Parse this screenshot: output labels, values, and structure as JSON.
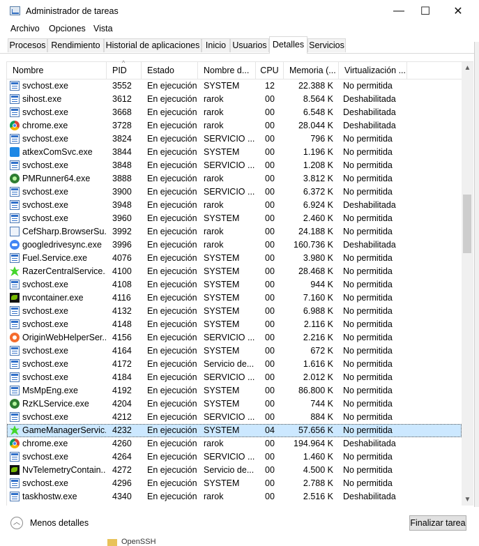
{
  "window": {
    "title": "Administrador de tareas",
    "minimize": "—",
    "maximize": "☐",
    "close": "✕"
  },
  "menu": [
    "Archivo",
    "Opciones",
    "Vista"
  ],
  "tabs": [
    {
      "label": "Procesos",
      "active": false
    },
    {
      "label": "Rendimiento",
      "active": false
    },
    {
      "label": "Historial de aplicaciones",
      "active": false
    },
    {
      "label": "Inicio",
      "active": false
    },
    {
      "label": "Usuarios",
      "active": false
    },
    {
      "label": "Detalles",
      "active": true
    },
    {
      "label": "Servicios",
      "active": false
    }
  ],
  "columns": [
    "Nombre",
    "PID",
    "Estado",
    "Nombre d...",
    "CPU",
    "Memoria (...",
    "Virtualización ..."
  ],
  "sort_indicator": "^",
  "rows": [
    {
      "icon": "svchost",
      "name": "svchost.exe",
      "pid": "3552",
      "status": "En ejecución",
      "user": "SYSTEM",
      "cpu": "12",
      "mem": "22.388 K",
      "virt": "No permitida"
    },
    {
      "icon": "svchost",
      "name": "sihost.exe",
      "pid": "3612",
      "status": "En ejecución",
      "user": "rarok",
      "cpu": "00",
      "mem": "8.564 K",
      "virt": "Deshabilitada"
    },
    {
      "icon": "svchost",
      "name": "svchost.exe",
      "pid": "3668",
      "status": "En ejecución",
      "user": "rarok",
      "cpu": "00",
      "mem": "6.548 K",
      "virt": "Deshabilitada"
    },
    {
      "icon": "chrome",
      "name": "chrome.exe",
      "pid": "3728",
      "status": "En ejecución",
      "user": "rarok",
      "cpu": "00",
      "mem": "28.044 K",
      "virt": "Deshabilitada"
    },
    {
      "icon": "svchost",
      "name": "svchost.exe",
      "pid": "3824",
      "status": "En ejecución",
      "user": "SERVICIO ...",
      "cpu": "00",
      "mem": "796 K",
      "virt": "No permitida"
    },
    {
      "icon": "cube",
      "name": "atkexComSvc.exe",
      "pid": "3844",
      "status": "En ejecución",
      "user": "SYSTEM",
      "cpu": "00",
      "mem": "1.196 K",
      "virt": "No permitida"
    },
    {
      "icon": "svchost",
      "name": "svchost.exe",
      "pid": "3848",
      "status": "En ejecución",
      "user": "SERVICIO ...",
      "cpu": "00",
      "mem": "1.208 K",
      "virt": "No permitida"
    },
    {
      "icon": "pm",
      "name": "PMRunner64.exe",
      "pid": "3888",
      "status": "En ejecución",
      "user": "rarok",
      "cpu": "00",
      "mem": "3.812 K",
      "virt": "No permitida"
    },
    {
      "icon": "svchost",
      "name": "svchost.exe",
      "pid": "3900",
      "status": "En ejecución",
      "user": "SERVICIO ...",
      "cpu": "00",
      "mem": "6.372 K",
      "virt": "No permitida"
    },
    {
      "icon": "svchost",
      "name": "svchost.exe",
      "pid": "3948",
      "status": "En ejecución",
      "user": "rarok",
      "cpu": "00",
      "mem": "6.924 K",
      "virt": "Deshabilitada"
    },
    {
      "icon": "svchost",
      "name": "svchost.exe",
      "pid": "3960",
      "status": "En ejecución",
      "user": "SYSTEM",
      "cpu": "00",
      "mem": "2.460 K",
      "virt": "No permitida"
    },
    {
      "icon": "cef",
      "name": "CefSharp.BrowserSu...",
      "pid": "3992",
      "status": "En ejecución",
      "user": "rarok",
      "cpu": "00",
      "mem": "24.188 K",
      "virt": "No permitida"
    },
    {
      "icon": "gdrive",
      "name": "googledrivesync.exe",
      "pid": "3996",
      "status": "En ejecución",
      "user": "rarok",
      "cpu": "00",
      "mem": "160.736 K",
      "virt": "Deshabilitada"
    },
    {
      "icon": "svchost",
      "name": "Fuel.Service.exe",
      "pid": "4076",
      "status": "En ejecución",
      "user": "SYSTEM",
      "cpu": "00",
      "mem": "3.980 K",
      "virt": "No permitida"
    },
    {
      "icon": "razer",
      "name": "RazerCentralService....",
      "pid": "4100",
      "status": "En ejecución",
      "user": "SYSTEM",
      "cpu": "00",
      "mem": "28.468 K",
      "virt": "No permitida"
    },
    {
      "icon": "svchost",
      "name": "svchost.exe",
      "pid": "4108",
      "status": "En ejecución",
      "user": "SYSTEM",
      "cpu": "00",
      "mem": "944 K",
      "virt": "No permitida"
    },
    {
      "icon": "nvidia",
      "name": "nvcontainer.exe",
      "pid": "4116",
      "status": "En ejecución",
      "user": "SYSTEM",
      "cpu": "00",
      "mem": "7.160 K",
      "virt": "No permitida"
    },
    {
      "icon": "svchost",
      "name": "svchost.exe",
      "pid": "4132",
      "status": "En ejecución",
      "user": "SYSTEM",
      "cpu": "00",
      "mem": "6.988 K",
      "virt": "No permitida"
    },
    {
      "icon": "svchost",
      "name": "svchost.exe",
      "pid": "4148",
      "status": "En ejecución",
      "user": "SYSTEM",
      "cpu": "00",
      "mem": "2.116 K",
      "virt": "No permitida"
    },
    {
      "icon": "origin",
      "name": "OriginWebHelperSer...",
      "pid": "4156",
      "status": "En ejecución",
      "user": "SERVICIO ...",
      "cpu": "00",
      "mem": "2.216 K",
      "virt": "No permitida"
    },
    {
      "icon": "svchost",
      "name": "svchost.exe",
      "pid": "4164",
      "status": "En ejecución",
      "user": "SYSTEM",
      "cpu": "00",
      "mem": "672 K",
      "virt": "No permitida"
    },
    {
      "icon": "svchost",
      "name": "svchost.exe",
      "pid": "4172",
      "status": "En ejecución",
      "user": "Servicio de...",
      "cpu": "00",
      "mem": "1.616 K",
      "virt": "No permitida"
    },
    {
      "icon": "svchost",
      "name": "svchost.exe",
      "pid": "4184",
      "status": "En ejecución",
      "user": "SERVICIO ...",
      "cpu": "00",
      "mem": "2.012 K",
      "virt": "No permitida"
    },
    {
      "icon": "svchost",
      "name": "MsMpEng.exe",
      "pid": "4192",
      "status": "En ejecución",
      "user": "SYSTEM",
      "cpu": "00",
      "mem": "86.800 K",
      "virt": "No permitida"
    },
    {
      "icon": "pm",
      "name": "RzKLService.exe",
      "pid": "4204",
      "status": "En ejecución",
      "user": "SYSTEM",
      "cpu": "00",
      "mem": "744 K",
      "virt": "No permitida"
    },
    {
      "icon": "svchost",
      "name": "svchost.exe",
      "pid": "4212",
      "status": "En ejecución",
      "user": "SERVICIO ...",
      "cpu": "00",
      "mem": "884 K",
      "virt": "No permitida"
    },
    {
      "icon": "razer",
      "name": "GameManagerServic...",
      "pid": "4232",
      "status": "En ejecución",
      "user": "SYSTEM",
      "cpu": "04",
      "mem": "57.656 K",
      "virt": "No permitida",
      "selected": true
    },
    {
      "icon": "chrome",
      "name": "chrome.exe",
      "pid": "4260",
      "status": "En ejecución",
      "user": "rarok",
      "cpu": "00",
      "mem": "194.964 K",
      "virt": "Deshabilitada"
    },
    {
      "icon": "svchost",
      "name": "svchost.exe",
      "pid": "4264",
      "status": "En ejecución",
      "user": "SERVICIO ...",
      "cpu": "00",
      "mem": "1.460 K",
      "virt": "No permitida"
    },
    {
      "icon": "nvidia",
      "name": "NvTelemetryContain...",
      "pid": "4272",
      "status": "En ejecución",
      "user": "Servicio de...",
      "cpu": "00",
      "mem": "4.500 K",
      "virt": "No permitida"
    },
    {
      "icon": "svchost",
      "name": "svchost.exe",
      "pid": "4296",
      "status": "En ejecución",
      "user": "SYSTEM",
      "cpu": "00",
      "mem": "2.788 K",
      "virt": "No permitida"
    },
    {
      "icon": "svchost",
      "name": "taskhostw.exe",
      "pid": "4340",
      "status": "En ejecución",
      "user": "rarok",
      "cpu": "00",
      "mem": "2.516 K",
      "virt": "Deshabilitada"
    }
  ],
  "footer": {
    "fewer_details": "Menos detalles",
    "end_task": "Finalizar tarea",
    "fewer_icon": "chevron-up-icon"
  },
  "background": {
    "folder_label": "OpenSSH"
  }
}
